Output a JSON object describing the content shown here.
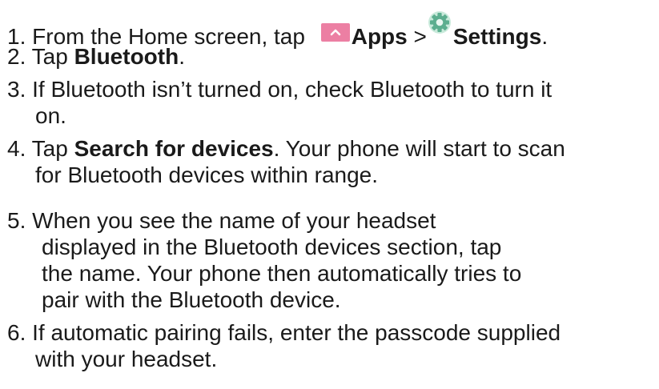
{
  "steps": [
    {
      "number": "1.",
      "before": "From the Home screen, tap",
      "apps_label": "Apps",
      "separator": ">",
      "settings_label": "Settings",
      "end": "."
    },
    {
      "number": "2.",
      "before": "Tap",
      "bold": "Bluetooth",
      "end": "."
    },
    {
      "number": "3.",
      "line1": "If Bluetooth isn’t turned on, check Bluetooth to turn it",
      "line2": "on."
    },
    {
      "number": "4.",
      "before": "Tap",
      "bold": "Search for devices",
      "after": ". Your phone will start to scan",
      "line2": "for Bluetooth devices within range."
    },
    {
      "number": "5.",
      "line1": "When you see the name of your headset",
      "line2": "displayed in the Bluetooth devices section, tap",
      "line3": "the name. Your phone then automatically tries to",
      "line4": "pair with the Bluetooth device."
    },
    {
      "number": "6.",
      "line1": "If automatic pairing fails, enter the passcode supplied",
      "line2": "with your headset."
    }
  ],
  "icons": {
    "apps": "apps-drawer-icon",
    "settings": "settings-gear-icon",
    "apps_color": "#ec7fa3",
    "settings_color": "#5cae8f"
  }
}
